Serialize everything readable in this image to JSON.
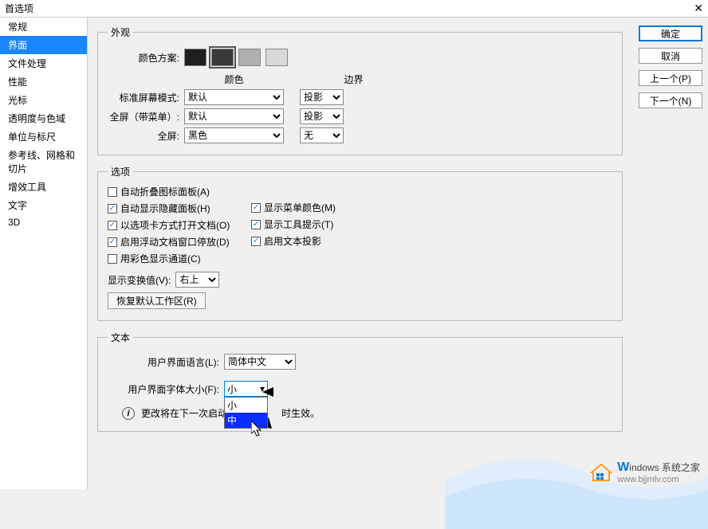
{
  "window": {
    "title": "首选项",
    "close_glyph": "✕"
  },
  "sidebar": {
    "items": [
      {
        "label": "常规"
      },
      {
        "label": "界面"
      },
      {
        "label": "文件处理"
      },
      {
        "label": "性能"
      },
      {
        "label": "光标"
      },
      {
        "label": "透明度与色域"
      },
      {
        "label": "单位与标尺"
      },
      {
        "label": "参考线、网格和切片"
      },
      {
        "label": "增效工具"
      },
      {
        "label": "文字"
      },
      {
        "label": "3D"
      }
    ],
    "active_index": 1
  },
  "right_buttons": {
    "ok": "确定",
    "cancel": "取消",
    "prev": "上一个(P)",
    "next": "下一个(N)"
  },
  "appearance": {
    "legend": "外观",
    "scheme_label": "颜色方案:",
    "swatches": [
      "#1e1e1e",
      "#3a3a3a",
      "#b0b0b0",
      "#d8d8d8"
    ],
    "selected_swatch": 1,
    "col_color": "颜色",
    "col_border": "边界",
    "rows": [
      {
        "label": "标准屏幕模式:",
        "color": "默认",
        "border": "投影"
      },
      {
        "label": "全屏（带菜单）:",
        "color": "默认",
        "border": "投影"
      },
      {
        "label": "全屏:",
        "color": "黑色",
        "border": "无"
      }
    ]
  },
  "options": {
    "legend": "选项",
    "checks_left": [
      {
        "label": "自动折叠图标面板(A)",
        "checked": false
      },
      {
        "label": "自动显示隐藏面板(H)",
        "checked": true
      },
      {
        "label": "以选项卡方式打开文档(O)",
        "checked": true
      },
      {
        "label": "启用浮动文档窗口停放(D)",
        "checked": true
      },
      {
        "label": "用彩色显示通道(C)",
        "checked": false
      }
    ],
    "checks_right": [
      {
        "label": "显示菜单颜色(M)",
        "checked": true
      },
      {
        "label": "显示工具提示(T)",
        "checked": true
      },
      {
        "label": "启用文本投影",
        "checked": true
      }
    ],
    "transform_label": "显示变换值(V):",
    "transform_value": "右上",
    "restore_btn": "恢复默认工作区(R)"
  },
  "text_section": {
    "legend": "文本",
    "lang_label": "用户界面语言(L):",
    "lang_value": "简体中文",
    "font_label": "用户界面字体大小(F):",
    "font_value": "小",
    "font_options": [
      "小",
      "中"
    ],
    "font_highlight_index": 1,
    "info_note_prefix": "更改将在下一次启动",
    "info_note_suffix": "时生效。",
    "info_glyph": "i",
    "dropdown_glyph": "▾"
  },
  "watermark": {
    "brand_prefix": "W",
    "brand_rest": "indows",
    "brand_tail": " 系统之家",
    "url": "www.bjjmlv.com"
  }
}
